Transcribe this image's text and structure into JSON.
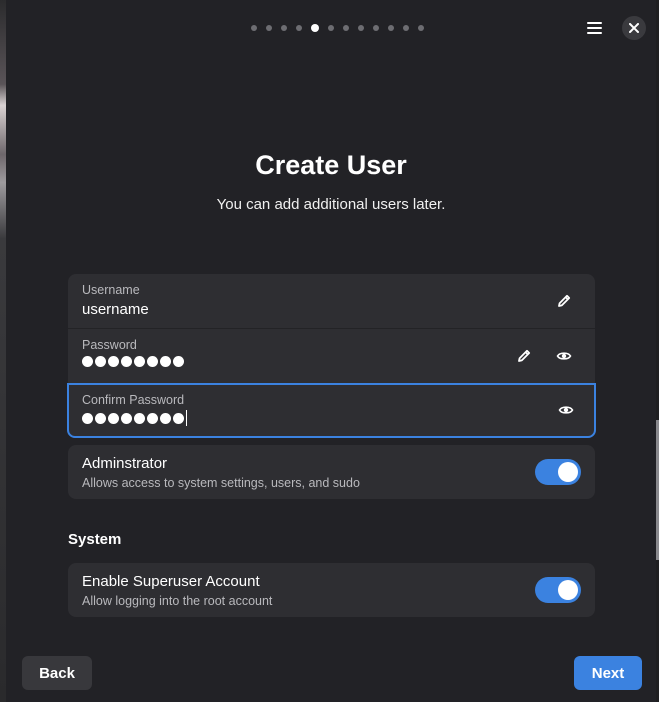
{
  "pager": {
    "count": 12,
    "active_index": 4
  },
  "header": {
    "menu_icon": "hamburger-menu-icon",
    "close_icon": "close-icon"
  },
  "page": {
    "title": "Create User",
    "subtitle": "You can add additional users later."
  },
  "fields": {
    "username": {
      "label": "Username",
      "value": "username",
      "icon": "pencil-icon"
    },
    "password": {
      "label": "Password",
      "masked_length": 8,
      "icons": [
        "pencil-icon",
        "eye-icon"
      ]
    },
    "confirm_password": {
      "label": "Confirm Password",
      "masked_length": 8,
      "icon": "eye-icon",
      "focused": true
    }
  },
  "admin": {
    "title": "Adminstrator",
    "description": "Allows access to system settings, users, and sudo",
    "enabled": true
  },
  "system": {
    "heading": "System",
    "superuser": {
      "title": "Enable Superuser Account",
      "description": "Allow logging into the root account",
      "enabled": true
    }
  },
  "footer": {
    "back_label": "Back",
    "next_label": "Next"
  },
  "colors": {
    "accent": "#3b82e0",
    "background": "#222226",
    "card": "#2e2e32"
  }
}
